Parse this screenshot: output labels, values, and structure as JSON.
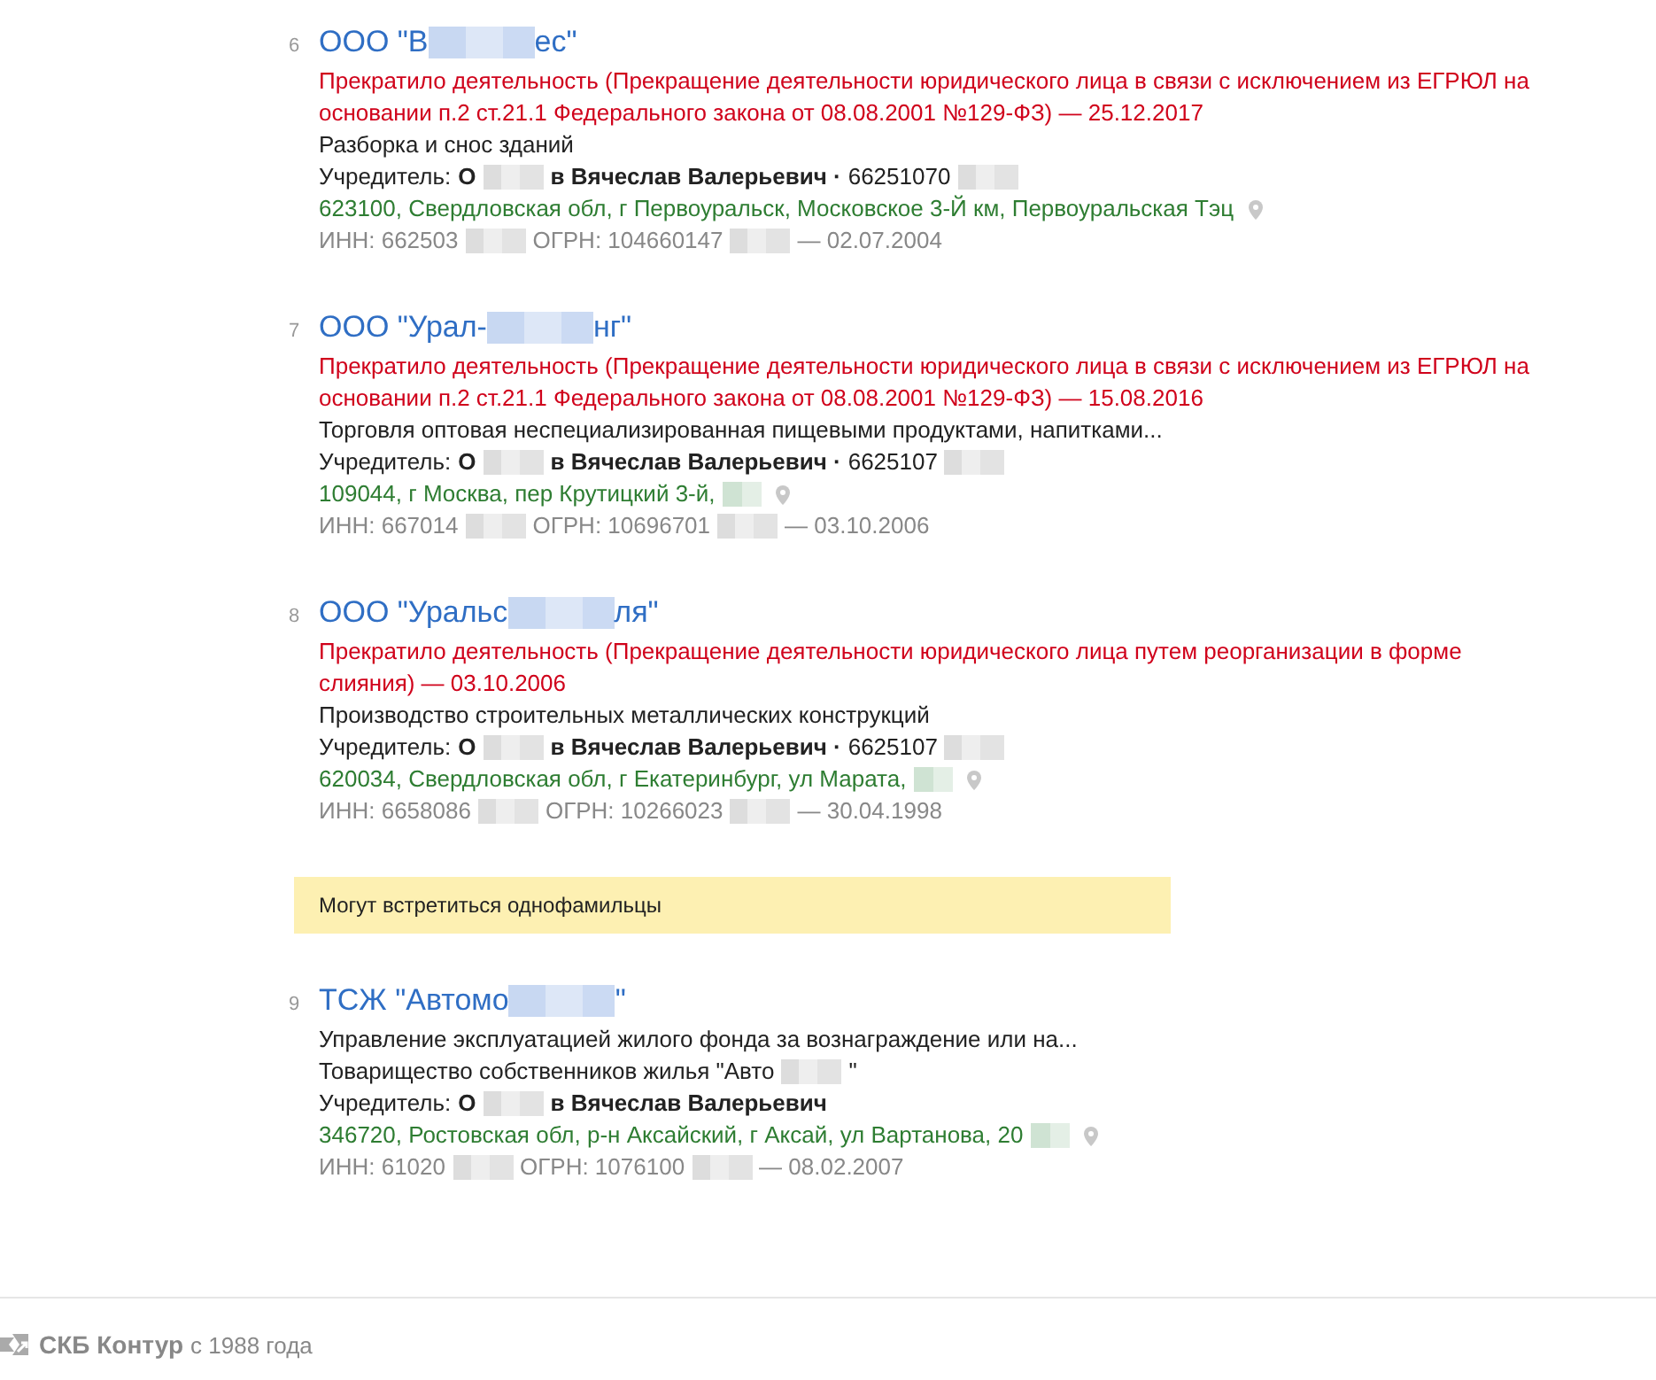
{
  "results": [
    {
      "number": "6",
      "title": [
        {
          "kind": "text",
          "text": "ООО \"В"
        },
        {
          "kind": "redaction"
        },
        {
          "kind": "text",
          "text": "ес\""
        }
      ],
      "status": "Прекратило деятельность (Прекращение деятельности юридического лица в связи с исключением из ЕГРЮЛ на основании п.2 ст.21.1 Федерального закона от 08.08.2001 №129-ФЗ) — 25.12.2017",
      "activity": "Разборка и снос зданий",
      "founder": [
        {
          "kind": "text",
          "text": "Учредитель:"
        },
        {
          "kind": "text",
          "text": "О",
          "bold": true
        },
        {
          "kind": "redaction"
        },
        {
          "kind": "text",
          "text": "в Вячеслав Валерьевич ·",
          "bold": true
        },
        {
          "kind": "text",
          "text": "66251070"
        },
        {
          "kind": "redaction"
        }
      ],
      "address": [
        {
          "kind": "text",
          "text": "623100, Свердловская обл, г Первоуральск, Московское 3-Й км, Первоуральская Тэц"
        }
      ],
      "registry": [
        {
          "kind": "text",
          "text": "ИНН: 662503"
        },
        {
          "kind": "redaction"
        },
        {
          "kind": "text",
          "text": "ОГРН: 104660147"
        },
        {
          "kind": "redaction"
        },
        {
          "kind": "text",
          "text": "— 02.07.2004"
        }
      ]
    },
    {
      "number": "7",
      "title": [
        {
          "kind": "text",
          "text": "ООО \"Урал-"
        },
        {
          "kind": "redaction"
        },
        {
          "kind": "text",
          "text": "нг\""
        }
      ],
      "status": "Прекратило деятельность (Прекращение деятельности юридического лица в связи с исключением из ЕГРЮЛ на основании п.2 ст.21.1 Федерального закона от 08.08.2001 №129-ФЗ) — 15.08.2016",
      "activity": "Торговля оптовая неспециализированная пищевыми продуктами, напитками...",
      "founder": [
        {
          "kind": "text",
          "text": "Учредитель:"
        },
        {
          "kind": "text",
          "text": "О",
          "bold": true
        },
        {
          "kind": "redaction"
        },
        {
          "kind": "text",
          "text": "в Вячеслав Валерьевич ·",
          "bold": true
        },
        {
          "kind": "text",
          "text": "6625107"
        },
        {
          "kind": "redaction"
        }
      ],
      "address": [
        {
          "kind": "text",
          "text": "109044, г Москва, пер Крутицкий 3-й,"
        },
        {
          "kind": "redaction"
        }
      ],
      "registry": [
        {
          "kind": "text",
          "text": "ИНН: 667014"
        },
        {
          "kind": "redaction"
        },
        {
          "kind": "text",
          "text": "ОГРН: 10696701"
        },
        {
          "kind": "redaction"
        },
        {
          "kind": "text",
          "text": "— 03.10.2006"
        }
      ]
    },
    {
      "number": "8",
      "title": [
        {
          "kind": "text",
          "text": "ООО \"Уральс"
        },
        {
          "kind": "redaction"
        },
        {
          "kind": "text",
          "text": "ля\""
        }
      ],
      "status": "Прекратило деятельность (Прекращение деятельности юридического лица путем реорганизации в форме слияния) — 03.10.2006",
      "activity": "Производство строительных металлических конструкций",
      "founder": [
        {
          "kind": "text",
          "text": "Учредитель:"
        },
        {
          "kind": "text",
          "text": "О",
          "bold": true
        },
        {
          "kind": "redaction"
        },
        {
          "kind": "text",
          "text": "в Вячеслав Валерьевич ·",
          "bold": true
        },
        {
          "kind": "text",
          "text": "6625107"
        },
        {
          "kind": "redaction"
        }
      ],
      "address": [
        {
          "kind": "text",
          "text": "620034, Свердловская обл, г Екатеринбург, ул Марата,"
        },
        {
          "kind": "redaction"
        }
      ],
      "registry": [
        {
          "kind": "text",
          "text": "ИНН: 6658086"
        },
        {
          "kind": "redaction"
        },
        {
          "kind": "text",
          "text": "ОГРН: 10266023"
        },
        {
          "kind": "redaction"
        },
        {
          "kind": "text",
          "text": "— 30.04.1998"
        }
      ]
    }
  ],
  "notice": "Могут встретиться однофамильцы",
  "namesakes": [
    {
      "number": "9",
      "title": [
        {
          "kind": "text",
          "text": "ТСЖ \"Автомо"
        },
        {
          "kind": "redaction"
        },
        {
          "kind": "text",
          "text": "\""
        }
      ],
      "activity": "Управление эксплуатацией жилого фонда за вознаграждение или на...",
      "full_name": [
        {
          "kind": "text",
          "text": "Товарищество собственников жилья \"Авто"
        },
        {
          "kind": "redaction"
        },
        {
          "kind": "text",
          "text": "\""
        }
      ],
      "founder": [
        {
          "kind": "text",
          "text": "Учредитель:"
        },
        {
          "kind": "text",
          "text": "О",
          "bold": true
        },
        {
          "kind": "redaction"
        },
        {
          "kind": "text",
          "text": "в Вячеслав Валерьевич",
          "bold": true
        }
      ],
      "address": [
        {
          "kind": "text",
          "text": "346720, Ростовская обл, р-н Аксайский, г Аксай, ул Вартанова, 20"
        },
        {
          "kind": "redaction"
        }
      ],
      "registry": [
        {
          "kind": "text",
          "text": "ИНН: 61020"
        },
        {
          "kind": "redaction"
        },
        {
          "kind": "text",
          "text": "ОГРН: 1076100"
        },
        {
          "kind": "redaction"
        },
        {
          "kind": "text",
          "text": "— 08.02.2007"
        }
      ]
    }
  ],
  "footer": {
    "brand": "СКБ Контур",
    "since": "с 1988 года"
  }
}
